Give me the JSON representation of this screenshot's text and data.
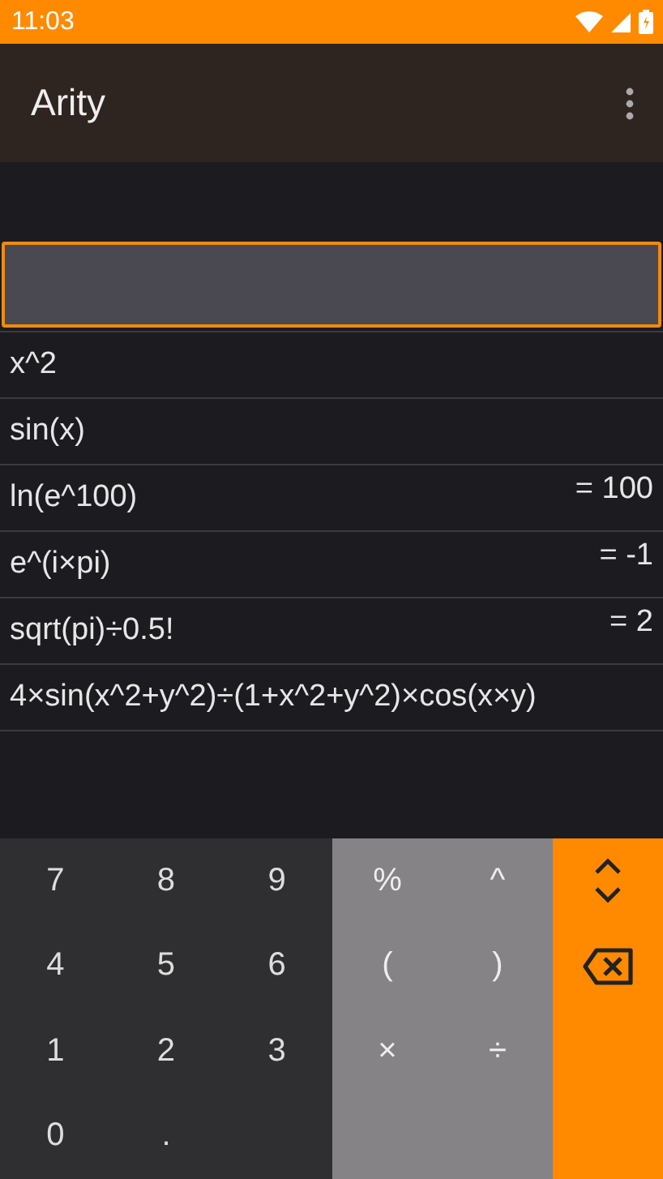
{
  "status_bar": {
    "time": "11:03"
  },
  "app_bar": {
    "title": "Arity"
  },
  "history": [
    {
      "expression": "x^2"
    },
    {
      "expression": "sin(x)"
    },
    {
      "expression": "ln(e^100)",
      "result": "= 100"
    },
    {
      "expression": "e^(i×pi)",
      "result": "= -1"
    },
    {
      "expression": "sqrt(pi)÷0.5!",
      "result": "= 2"
    },
    {
      "expression": "4×sin(x^2+y^2)÷(1+x^2+y^2)×cos(x×y)"
    }
  ],
  "keypad": {
    "digits": [
      [
        "7",
        "8",
        "9"
      ],
      [
        "4",
        "5",
        "6"
      ],
      [
        "1",
        "2",
        "3"
      ],
      [
        "0",
        "."
      ]
    ],
    "operators": [
      [
        "%",
        "^"
      ],
      [
        "(",
        ")"
      ],
      [
        "×",
        "÷"
      ]
    ]
  }
}
